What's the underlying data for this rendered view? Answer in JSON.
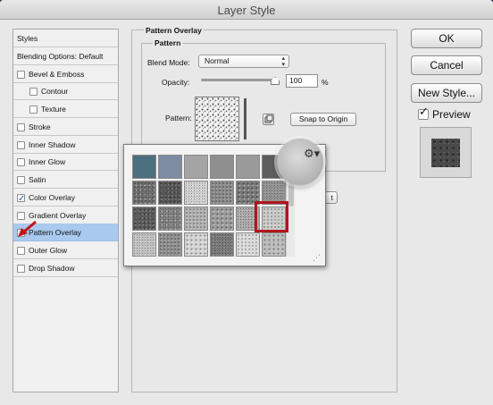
{
  "window": {
    "title": "Layer Style"
  },
  "styles_panel": {
    "items": [
      {
        "label": "Styles",
        "checkbox": false,
        "checked": false,
        "indent": 0,
        "selected": false
      },
      {
        "label": "Blending Options: Default",
        "checkbox": false,
        "checked": false,
        "indent": 0,
        "selected": false
      },
      {
        "label": "Bevel & Emboss",
        "checkbox": true,
        "checked": false,
        "indent": 0,
        "selected": false
      },
      {
        "label": "Contour",
        "checkbox": true,
        "checked": false,
        "indent": 1,
        "selected": false
      },
      {
        "label": "Texture",
        "checkbox": true,
        "checked": false,
        "indent": 1,
        "selected": false
      },
      {
        "label": "Stroke",
        "checkbox": true,
        "checked": false,
        "indent": 0,
        "selected": false
      },
      {
        "label": "Inner Shadow",
        "checkbox": true,
        "checked": false,
        "indent": 0,
        "selected": false
      },
      {
        "label": "Inner Glow",
        "checkbox": true,
        "checked": false,
        "indent": 0,
        "selected": false
      },
      {
        "label": "Satin",
        "checkbox": true,
        "checked": false,
        "indent": 0,
        "selected": false
      },
      {
        "label": "Color Overlay",
        "checkbox": true,
        "checked": true,
        "indent": 0,
        "selected": false
      },
      {
        "label": "Gradient Overlay",
        "checkbox": true,
        "checked": false,
        "indent": 0,
        "selected": false
      },
      {
        "label": "Pattern Overlay",
        "checkbox": true,
        "checked": true,
        "indent": 0,
        "selected": true
      },
      {
        "label": "Outer Glow",
        "checkbox": true,
        "checked": false,
        "indent": 0,
        "selected": false
      },
      {
        "label": "Drop Shadow",
        "checkbox": true,
        "checked": false,
        "indent": 0,
        "selected": false
      }
    ]
  },
  "pattern_overlay": {
    "group_title": "Pattern Overlay",
    "subgroup_title": "Pattern",
    "blend_mode_label": "Blend Mode:",
    "blend_mode_value": "Normal",
    "opacity_label": "Opacity:",
    "opacity_value": "100",
    "opacity_unit": "%",
    "opacity_fraction": 1.0,
    "pattern_label": "Pattern:",
    "snap_button": "Snap to Origin",
    "partial_button": "t"
  },
  "pattern_picker": {
    "selected_index": 18,
    "swatch_colors": [
      "#4c6f80",
      "#7d8ca2",
      "#a4a4a4",
      "#8f8f8f",
      "#9a9a9a",
      "#5d5d5d",
      "#2b1ea8",
      "#6f6f6f",
      "#555555",
      "#cfcfcf",
      "#8a8a8a",
      "#7a7a7a",
      "#909090",
      "#c3c3c3",
      "#5a5a5a",
      "#7f7f7f",
      "#b0b0b0",
      "#9c9c9c",
      "#a8a8a8",
      "#c9c9c9",
      "#999999",
      "#c0c0c0",
      "#8e8e8e",
      "#d4d4d4",
      "#777777",
      "#dadada",
      "#bbbbbb",
      "#d0d0d0"
    ]
  },
  "side_buttons": {
    "ok": "OK",
    "cancel": "Cancel",
    "new_style": "New Style..."
  },
  "preview": {
    "label": "Preview",
    "checked": true
  },
  "colors": {
    "selection": "#a9c9ee",
    "highlight_border": "#b0161c",
    "check_blue": "#2a5fb5"
  }
}
